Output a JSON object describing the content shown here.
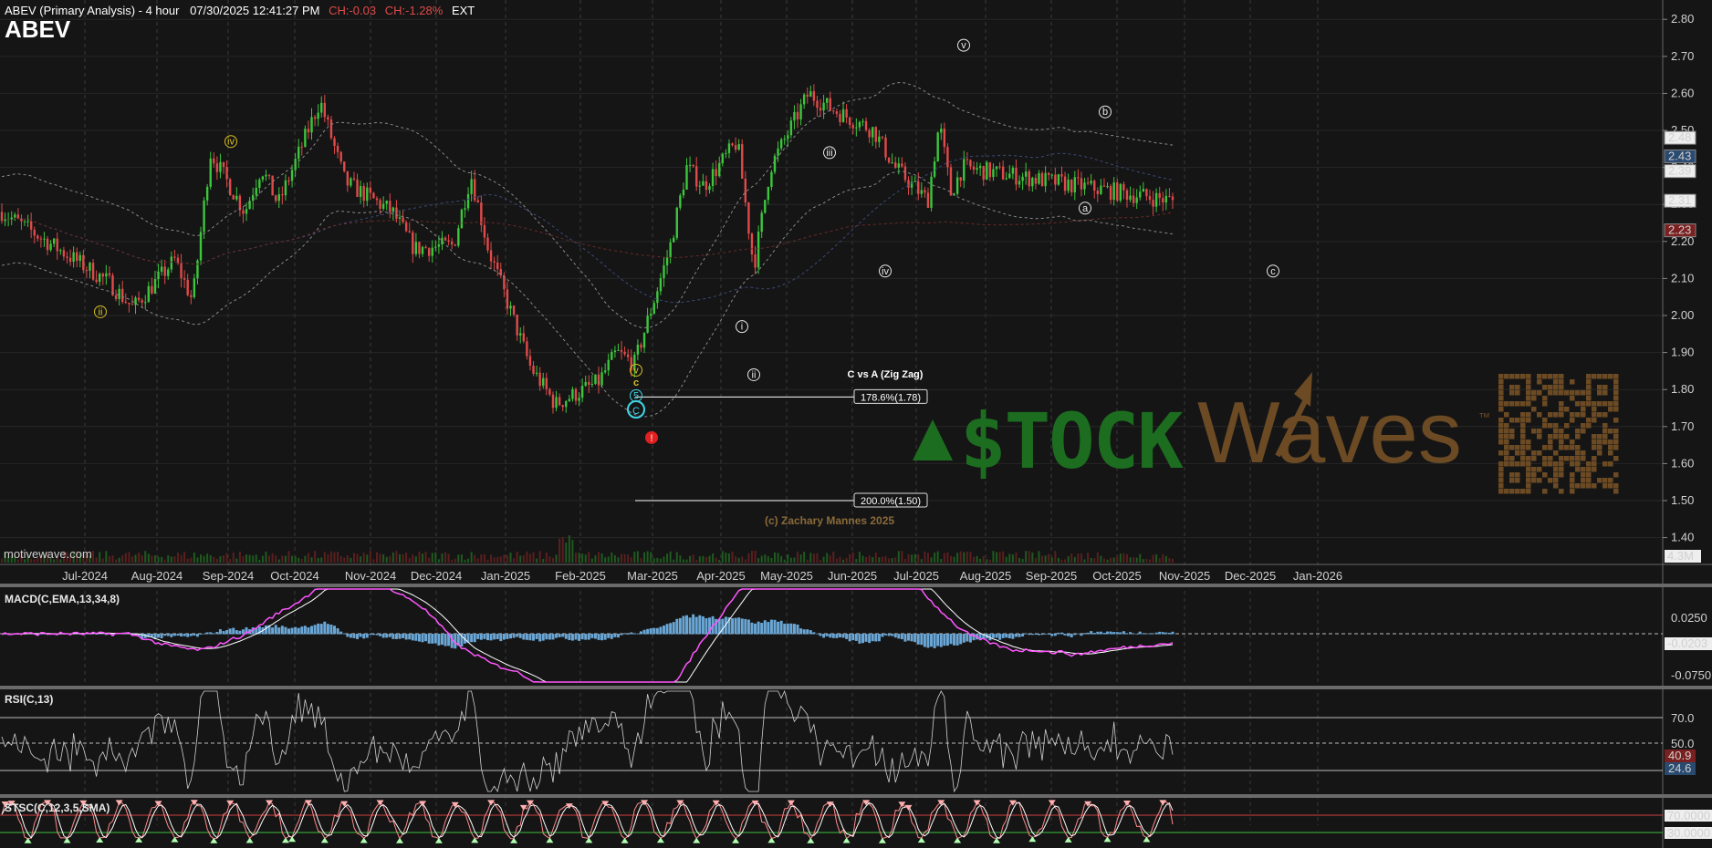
{
  "header": {
    "title": "ABEV (Primary Analysis) - 4 hour",
    "datetime": "07/30/2025 12:41:27 PM",
    "change_abs": "CH:-0.03",
    "change_pct": "CH:-1.28%",
    "session": "EXT",
    "ticker": "ABEV"
  },
  "source": "motivewave.com",
  "copyright": "(c) Zachary Mannes 2025",
  "watermark": {
    "stock": "$TOCK",
    "waves": "Waves",
    "tm": "™"
  },
  "colors": {
    "up": "#3cc63c",
    "down": "#e04a4a",
    "background": "#151515",
    "macd": "#ff55ff",
    "hist": "#6aa7d6",
    "wave_major": "#3fd6e8",
    "wave_minor": "#d8c020",
    "fib": "#ffffff"
  },
  "panels": {
    "macd": {
      "label": "MACD(C,EMA,13,34,8)",
      "ticks": [
        "0.0250",
        "-0.0750"
      ],
      "last": "-0.0203"
    },
    "rsi": {
      "label": "RSI(C,13)",
      "ticks": [
        "70.0",
        "50.0",
        "30.0"
      ],
      "last": "40.9",
      "signal": "24.6"
    },
    "stoch": {
      "label": "STSC(C,12,3,5,SMA)",
      "ticks": [
        "70.0000",
        "30.0000"
      ]
    }
  },
  "chart_data": {
    "type": "candlestick",
    "timeframe": "4 hour",
    "x_tick_labels": [
      "Jul-2024",
      "Aug-2024",
      "Sep-2024",
      "Oct-2024",
      "Nov-2024",
      "Dec-2024",
      "Jan-2025",
      "Feb-2025",
      "Mar-2025",
      "Apr-2025",
      "May-2025",
      "Jun-2025",
      "Jul-2025",
      "Aug-2025",
      "Sep-2025",
      "Oct-2025",
      "Nov-2025",
      "Dec-2025",
      "Jan-2026"
    ],
    "y_tick_labels": [
      "2.80",
      "2.70",
      "2.60",
      "2.50",
      "2.40",
      "2.30",
      "2.20",
      "2.10",
      "2.00",
      "1.90",
      "1.80",
      "1.70",
      "1.60",
      "1.50",
      "1.40"
    ],
    "ylim": [
      1.33,
      2.84
    ],
    "price_path": [
      {
        "t": "Jun-2024",
        "p": 2.28
      },
      {
        "t": "Jul-2024",
        "p": 2.09
      },
      {
        "t": "Jul-2024",
        "p": 2.02
      },
      {
        "t": "Aug-2024",
        "p": 2.15
      },
      {
        "t": "Aug-2024",
        "p": 2.04
      },
      {
        "t": "Aug-2024",
        "p": 2.44
      },
      {
        "t": "Sep-2024",
        "p": 2.28
      },
      {
        "t": "Sep-2024",
        "p": 2.4
      },
      {
        "t": "Sep-2024",
        "p": 2.3
      },
      {
        "t": "Oct-2024",
        "p": 2.58
      },
      {
        "t": "Oct-2024",
        "p": 2.36
      },
      {
        "t": "Nov-2024",
        "p": 2.28
      },
      {
        "t": "Nov-2024",
        "p": 2.18
      },
      {
        "t": "Dec-2024",
        "p": 2.19
      },
      {
        "t": "Dec-2024",
        "p": 2.38
      },
      {
        "t": "Dec-2024",
        "p": 2.18
      },
      {
        "t": "Jan-2025",
        "p": 1.86
      },
      {
        "t": "Jan-2025",
        "p": 1.76
      },
      {
        "t": "Feb-2025",
        "p": 1.82
      },
      {
        "t": "Feb-2025",
        "p": 1.9
      },
      {
        "t": "Feb-2025",
        "p": 1.87
      },
      {
        "t": "Mar-2025",
        "p": 2.18
      },
      {
        "t": "Mar-2025",
        "p": 2.4
      },
      {
        "t": "Mar-2025",
        "p": 2.35
      },
      {
        "t": "Apr-2025",
        "p": 2.47
      },
      {
        "t": "Apr-2025",
        "p": 2.13
      },
      {
        "t": "Apr-2025",
        "p": 2.4
      },
      {
        "t": "May-2025",
        "p": 2.6
      },
      {
        "t": "May-2025",
        "p": 2.56
      },
      {
        "t": "Jun-2025",
        "p": 2.5
      },
      {
        "t": "Jun-2025",
        "p": 2.4
      },
      {
        "t": "Jul-2025",
        "p": 2.31
      },
      {
        "t": "Jul-2025",
        "p": 2.52
      },
      {
        "t": "Jul-2025",
        "p": 2.33
      },
      {
        "t": "Jul-2025",
        "p": 2.4
      },
      {
        "t": "Jul-2025",
        "p": 2.31
      }
    ],
    "price_labels": [
      {
        "value": 2.48,
        "text": "2.48",
        "color": "#d0d0d0"
      },
      {
        "value": 2.43,
        "text": "2.43",
        "color": "#6aa7d6"
      },
      {
        "value": 2.39,
        "text": "2.39",
        "color": "#d0d0d0"
      },
      {
        "value": 2.31,
        "text": "2.31",
        "color": "#ffffff"
      },
      {
        "value": 2.23,
        "text": "2.23",
        "color": "#e04a4a"
      }
    ],
    "volume_label": "4.3M",
    "fib_levels": [
      {
        "label": "178.6%(1.78)",
        "value": 1.78
      },
      {
        "label": "200.0%(1.50)",
        "value": 1.5
      }
    ],
    "fib_title": "C vs A (Zig Zag)",
    "wave_labels": [
      {
        "text": "ii",
        "t": "Jul-2024",
        "price": 2.01,
        "group": "minor"
      },
      {
        "text": "iv",
        "t": "Aug-2024",
        "price": 2.47,
        "group": "minor"
      },
      {
        "text": "v",
        "t": "Jan-2025",
        "price": 1.72,
        "group": "minor"
      },
      {
        "text": "c",
        "t": "Jan-2025",
        "price": 1.7,
        "group": "minor"
      },
      {
        "text": "5",
        "t": "Jan-2025",
        "price": 1.68,
        "group": "major"
      },
      {
        "text": "C",
        "t": "Jan-2025",
        "price": 1.65,
        "group": "major"
      },
      {
        "text": "!",
        "t": "Jan-2025",
        "price": 1.67,
        "group": "alert"
      },
      {
        "text": "i",
        "t": "Feb-2025",
        "price": 1.97,
        "group": "white"
      },
      {
        "text": "ii",
        "t": "Feb-2025",
        "price": 1.84,
        "group": "white"
      },
      {
        "text": "iii",
        "t": "Mar-2025",
        "price": 2.44,
        "group": "white"
      },
      {
        "text": "iv",
        "t": "Apr-2025",
        "price": 2.12,
        "group": "white"
      },
      {
        "text": "v",
        "t": "May-2025",
        "price": 2.73,
        "group": "white"
      },
      {
        "text": "a",
        "t": "Jun-2025",
        "price": 2.29,
        "group": "white"
      },
      {
        "text": "b",
        "t": "Jul-2025",
        "price": 2.55,
        "group": "white"
      },
      {
        "text": "c",
        "t": "Aug-2025",
        "price": 2.12,
        "group": "white"
      }
    ]
  }
}
